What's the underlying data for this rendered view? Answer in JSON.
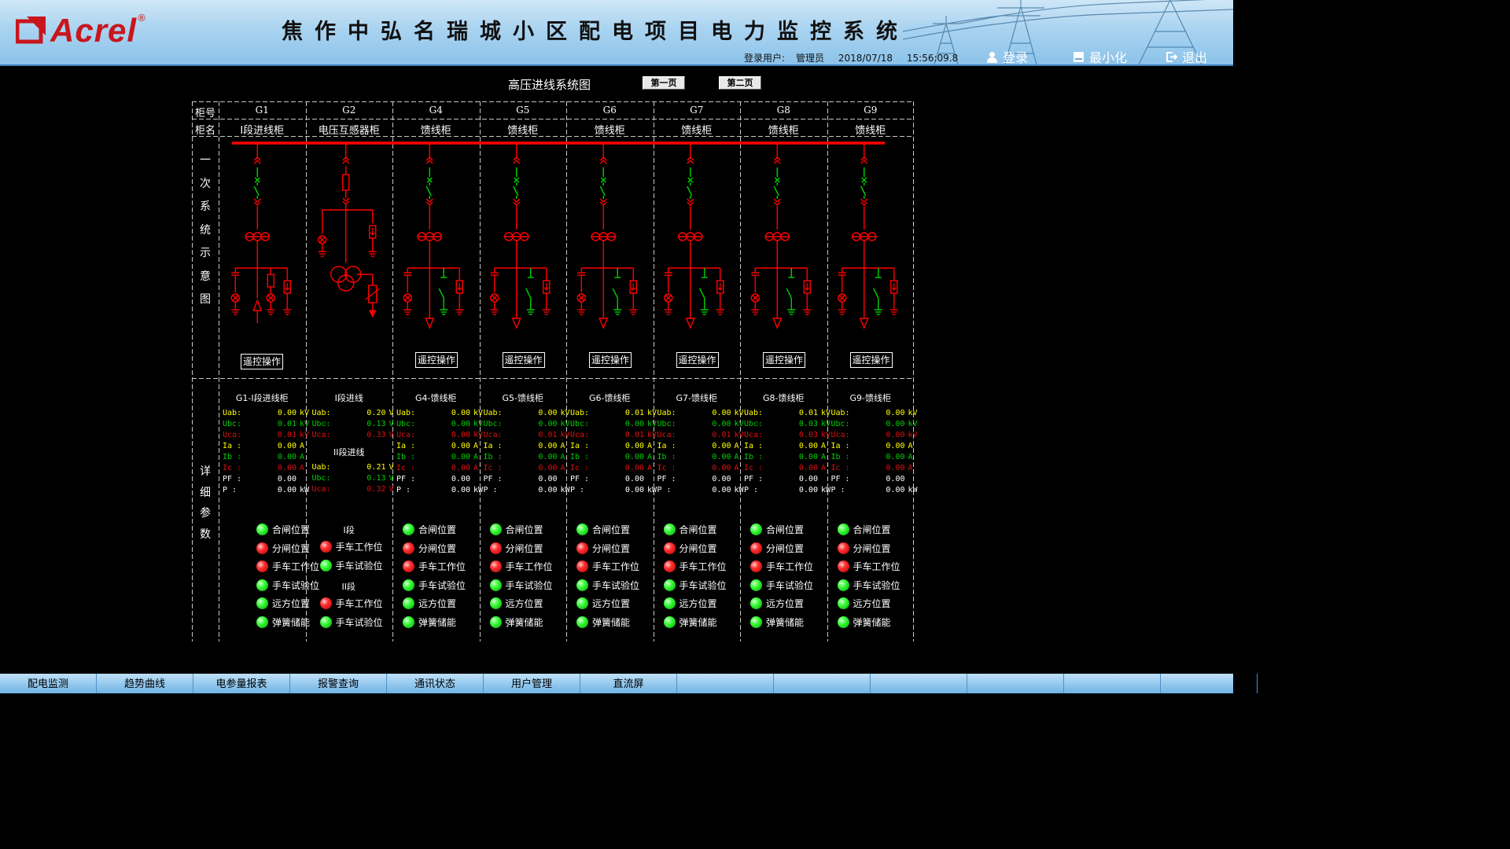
{
  "brand": {
    "name": "Acrel",
    "reg": "®"
  },
  "header": {
    "title": "焦作中弘名瑞城小区配电项目电力监控系统",
    "user_label": "登录用户:",
    "user": "管理员",
    "date": "2018/07/18",
    "time": "15:56:09.8",
    "login": "登录",
    "minimize": "最小化",
    "exit": "退出"
  },
  "page": {
    "title": "高压进线系统图",
    "btn_page1": "第一页",
    "btn_page2": "第二页"
  },
  "grid": {
    "row_label_id": "柜号",
    "row_label_name": "柜名",
    "side_diagram": [
      "一",
      "次",
      "系",
      "统",
      "示",
      "意",
      "图"
    ],
    "side_params": [
      "详",
      "细",
      "参",
      "数"
    ]
  },
  "colors": {
    "bus": "#ff0000",
    "green": "#00d000",
    "red": "#e01010",
    "yellow": "#ffff00"
  },
  "cabinets": [
    {
      "id": "G1",
      "name": "I段进线柜",
      "remote": "遥控操作",
      "meas_title": "G1-I段进线柜"
    },
    {
      "id": "G2",
      "name": "电压互感器柜",
      "remote": "",
      "meas_title": "I段进线"
    },
    {
      "id": "G4",
      "name": "馈线柜",
      "remote": "遥控操作",
      "meas_title": "G4-馈线柜"
    },
    {
      "id": "G5",
      "name": "馈线柜",
      "remote": "遥控操作",
      "meas_title": "G5-馈线柜"
    },
    {
      "id": "G6",
      "name": "馈线柜",
      "remote": "遥控操作",
      "meas_title": "G6-馈线柜"
    },
    {
      "id": "G7",
      "name": "馈线柜",
      "remote": "遥控操作",
      "meas_title": "G7-馈线柜"
    },
    {
      "id": "G8",
      "name": "馈线柜",
      "remote": "遥控操作",
      "meas_title": "G8-馈线柜"
    },
    {
      "id": "G9",
      "name": "馈线柜",
      "remote": "遥控操作",
      "meas_title": "G9-馈线柜"
    }
  ],
  "meas_labels": [
    "Uab:",
    "Ubc:",
    "Uca:",
    "Ia :",
    "Ib :",
    "Ic :",
    "PF :",
    "P  :"
  ],
  "meas": [
    [
      "0.00",
      "0.01",
      "0.01",
      "0.00",
      "0.00",
      "0.00",
      "0.00",
      "0.00"
    ],
    [
      "0.20",
      "0.13",
      "0.33"
    ],
    [
      "0.00",
      "0.00",
      "0.00",
      "0.00",
      "0.00",
      "0.00",
      "0.00",
      "0.00"
    ],
    [
      "0.00",
      "0.00",
      "0.01",
      "0.00",
      "0.00",
      "0.00",
      "0.00",
      "0.00"
    ],
    [
      "0.01",
      "0.00",
      "0.01",
      "0.00",
      "0.00",
      "0.00",
      "0.00",
      "0.00"
    ],
    [
      "0.00",
      "0.00",
      "0.01",
      "0.00",
      "0.00",
      "0.00",
      "0.00",
      "0.00"
    ],
    [
      "0.01",
      "0.03",
      "0.03",
      "0.00",
      "0.00",
      "0.00",
      "0.00",
      "0.00"
    ],
    [
      "0.00",
      "0.00",
      "0.00",
      "0.00",
      "0.00",
      "0.00",
      "0.00",
      "0.00"
    ]
  ],
  "units_kv": [
    "kV",
    "kV",
    "kV",
    "A",
    "A",
    "A",
    "",
    "kW"
  ],
  "units_v": [
    "V",
    "V",
    "V"
  ],
  "g2_ii": {
    "title": "II段进线",
    "values": [
      "0.21",
      "0.13",
      "0.32"
    ]
  },
  "status_labels": [
    "合闸位置",
    "分闸位置",
    "手车工作位",
    "手车试验位",
    "远方位置",
    "弹簧储能"
  ],
  "status_leds": [
    "g",
    "r",
    "r",
    "g",
    "g",
    "g"
  ],
  "g2_status": {
    "sec1": "I段",
    "sec2": "II段",
    "labels": [
      "手车工作位",
      "手车试验位"
    ],
    "leds1": [
      "r",
      "g"
    ],
    "leds2": [
      "r",
      "g"
    ]
  },
  "nav": [
    "配电监测",
    "趋势曲线",
    "电参量报表",
    "报警查询",
    "通讯状态",
    "用户管理",
    "直流屏",
    "",
    "",
    "",
    "",
    "",
    ""
  ]
}
